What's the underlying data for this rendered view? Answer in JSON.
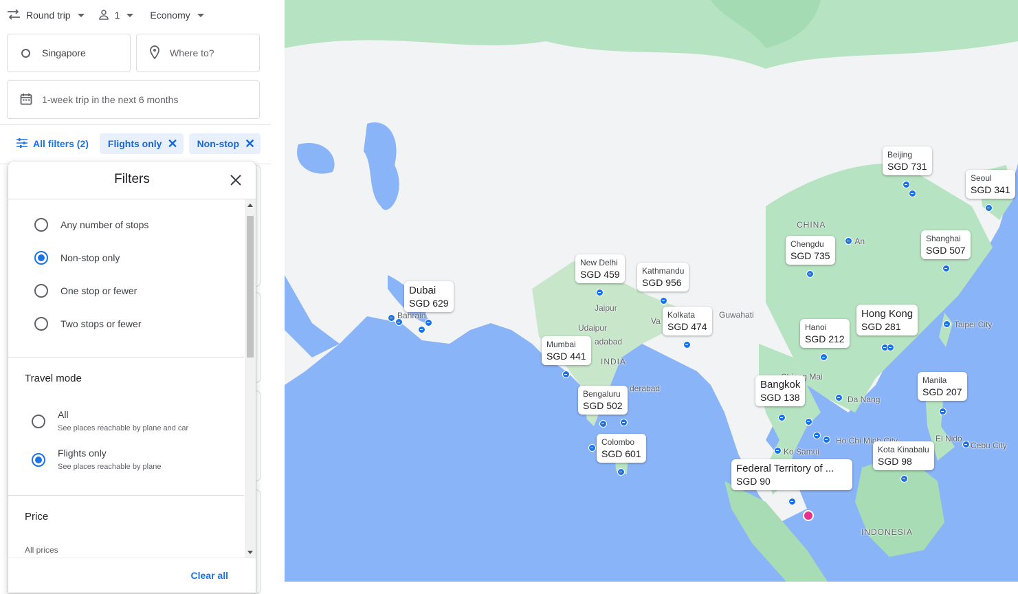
{
  "search": {
    "trip_type": "Round trip",
    "passengers": "1",
    "cabin": "Economy",
    "origin": "Singapore",
    "destination_placeholder": "Where to?",
    "dates": "1-week trip in the next 6 months"
  },
  "filter_chips": {
    "all_filters": "All filters (2)",
    "chips": [
      "Flights only",
      "Non-stop"
    ]
  },
  "filters_panel": {
    "title": "Filters",
    "stops": {
      "options": [
        "Any number of stops",
        "Non-stop only",
        "One stop or fewer",
        "Two stops or fewer"
      ],
      "selected": "Non-stop only"
    },
    "travel_mode": {
      "title": "Travel mode",
      "options": [
        {
          "label": "All",
          "desc": "See places reachable by plane and car"
        },
        {
          "label": "Flights only",
          "desc": "See places reachable by plane"
        }
      ],
      "selected": "Flights only"
    },
    "price": {
      "title": "Price",
      "value": "All prices"
    },
    "clear_all": "Clear all"
  },
  "map": {
    "destinations": [
      {
        "city": "Dubai",
        "price": "SGD 629"
      },
      {
        "city": "New Delhi",
        "price": "SGD 459"
      },
      {
        "city": "Kathmandu",
        "price": "SGD 956"
      },
      {
        "city": "Mumbai",
        "price": "SGD 441"
      },
      {
        "city": "Kolkata",
        "price": "SGD 474"
      },
      {
        "city": "Bengaluru",
        "price": "SGD 502"
      },
      {
        "city": "Colombo",
        "price": "SGD 601"
      },
      {
        "city": "Beijing",
        "price": "SGD 731"
      },
      {
        "city": "Seoul",
        "price": "SGD 341"
      },
      {
        "city": "Chengdu",
        "price": "SGD 735"
      },
      {
        "city": "Shanghai",
        "price": "SGD 507"
      },
      {
        "city": "Hanoi",
        "price": "SGD 212"
      },
      {
        "city": "Hong Kong",
        "price": "SGD 281"
      },
      {
        "city": "Bangkok",
        "price": "SGD 138"
      },
      {
        "city": "Manila",
        "price": "SGD 207"
      },
      {
        "city": "Kota Kinabalu",
        "price": "SGD 98"
      },
      {
        "city": "Federal Territory of ...",
        "price": "SGD 90"
      }
    ],
    "place_labels": [
      "Xi An",
      "Jaipur",
      "Udaipur",
      "adabad",
      "Va",
      "Guwahati",
      "Taipei City",
      "Bahrain",
      "Chiang Mai",
      "Da Nang",
      "Ho Chi Minh City",
      "Ko Samui",
      "El Nido",
      "Cebu City",
      "derabad"
    ],
    "country_labels": [
      "CHINA",
      "INDIA",
      "INDONESIA"
    ],
    "colors": {
      "water": "#8ab4f8",
      "land": "#f1f3f4",
      "green": "#b6e3c1",
      "accent": "#1a73e8",
      "origin": "#e8318a"
    }
  }
}
